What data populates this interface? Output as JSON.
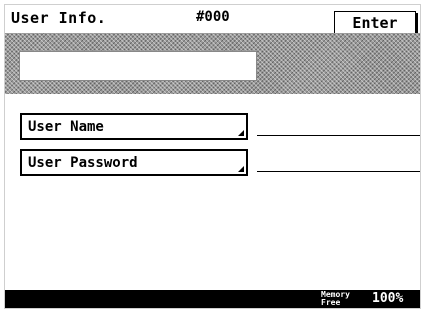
{
  "header": {
    "title": "User Info.",
    "number": "#000",
    "enter_label": "Enter"
  },
  "input": {
    "value": ""
  },
  "fields": [
    {
      "label": "User Name",
      "value": ""
    },
    {
      "label": "User Password",
      "value": ""
    }
  ],
  "footer": {
    "memory_label_1": "Memory",
    "memory_label_2": "Free",
    "memory_value": "100%"
  },
  "colors": {
    "background": "#ffffff",
    "foreground": "#000000",
    "band": "#9a9a9a"
  }
}
